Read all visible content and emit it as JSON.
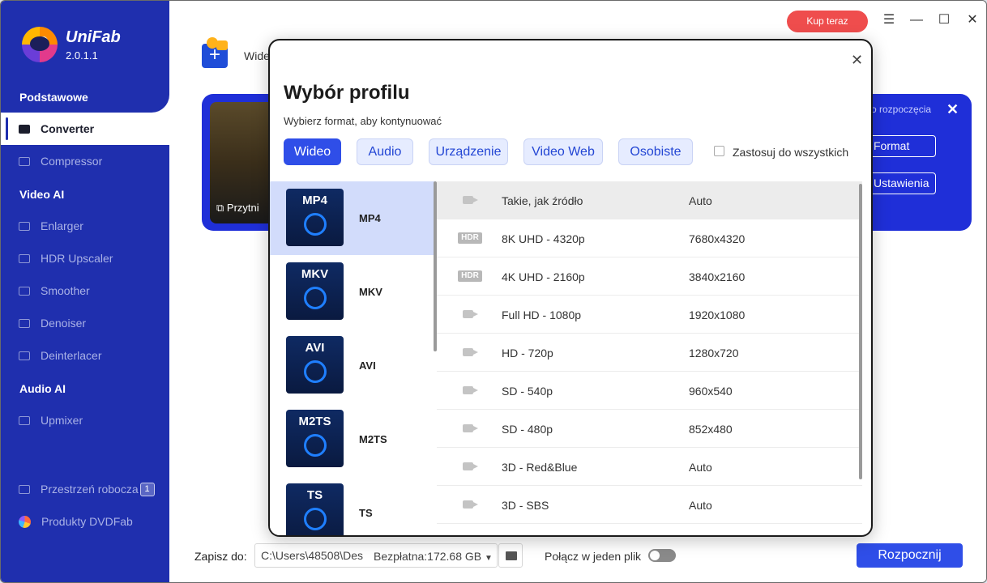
{
  "app": {
    "brand": "UniFab",
    "version": "2.0.1.1"
  },
  "topbar": {
    "buy_label": "Kup teraz"
  },
  "sidebar": {
    "sections": [
      {
        "title": "Podstawowe"
      },
      {
        "title": "Video AI"
      },
      {
        "title": "Audio AI"
      }
    ],
    "items": [
      {
        "label": "Converter",
        "active": true
      },
      {
        "label": "Compressor"
      },
      {
        "label": "Enlarger"
      },
      {
        "label": "HDR Upscaler"
      },
      {
        "label": "Smoother"
      },
      {
        "label": "Denoiser"
      },
      {
        "label": "Deinterlacer"
      },
      {
        "label": "Upmixer"
      },
      {
        "label": "Przestrzeń robocza",
        "badge": "1"
      },
      {
        "label": "Produkty DVDFab"
      }
    ]
  },
  "main": {
    "add_label": "Wide",
    "task": {
      "thumb_label": "Przytni",
      "start_text": "o rozpoczęcia",
      "format_label": "Format",
      "settings_label": "Ustawienia"
    }
  },
  "bottom": {
    "save_label": "Zapisz do:",
    "path": "C:\\Users\\48508\\Des",
    "free_space": "Bezpłatna:172.68 GB",
    "merge_label": "Połącz w jeden plik",
    "start_label": "Rozpocznij"
  },
  "modal": {
    "title": "Wybór profilu",
    "subtitle": "Wybierz format, aby kontynuować",
    "tabs": [
      {
        "label": "Wideo",
        "active": true
      },
      {
        "label": "Audio"
      },
      {
        "label": "Urządzenie"
      },
      {
        "label": "Video Web"
      },
      {
        "label": "Osobiste"
      }
    ],
    "apply_all_label": "Zastosuj do wszystkich",
    "formats": [
      {
        "icon_label": "MP4",
        "name": "MP4",
        "active": true
      },
      {
        "icon_label": "MKV",
        "name": "MKV"
      },
      {
        "icon_label": "AVI",
        "name": "AVI"
      },
      {
        "icon_label": "M2TS",
        "name": "M2TS"
      },
      {
        "icon_label": "TS",
        "name": "TS"
      }
    ],
    "resolutions": [
      {
        "icon": "camera-icon",
        "name": "Takie, jak źródło",
        "value": "Auto",
        "selected": true
      },
      {
        "icon": "hdr-icon",
        "hdr_label": "HDR",
        "name": "8K UHD - 4320p",
        "value": "7680x4320"
      },
      {
        "icon": "hdr-icon",
        "hdr_label": "HDR",
        "name": "4K UHD - 2160p",
        "value": "3840x2160"
      },
      {
        "icon": "camera-icon",
        "name": "Full HD - 1080p",
        "value": "1920x1080"
      },
      {
        "icon": "camera-icon",
        "name": "HD - 720p",
        "value": "1280x720"
      },
      {
        "icon": "camera-icon",
        "name": "SD - 540p",
        "value": "960x540"
      },
      {
        "icon": "camera-icon",
        "name": "SD - 480p",
        "value": "852x480"
      },
      {
        "icon": "camera-icon",
        "name": "3D - Red&Blue",
        "value": "Auto"
      },
      {
        "icon": "camera-icon",
        "name": "3D - SBS",
        "value": "Auto"
      }
    ]
  },
  "colors": {
    "sidebar": "#1f2fae",
    "accent": "#2f4ee8",
    "buy": "#ef4d4d",
    "selected_format": "#d2dcfb"
  }
}
